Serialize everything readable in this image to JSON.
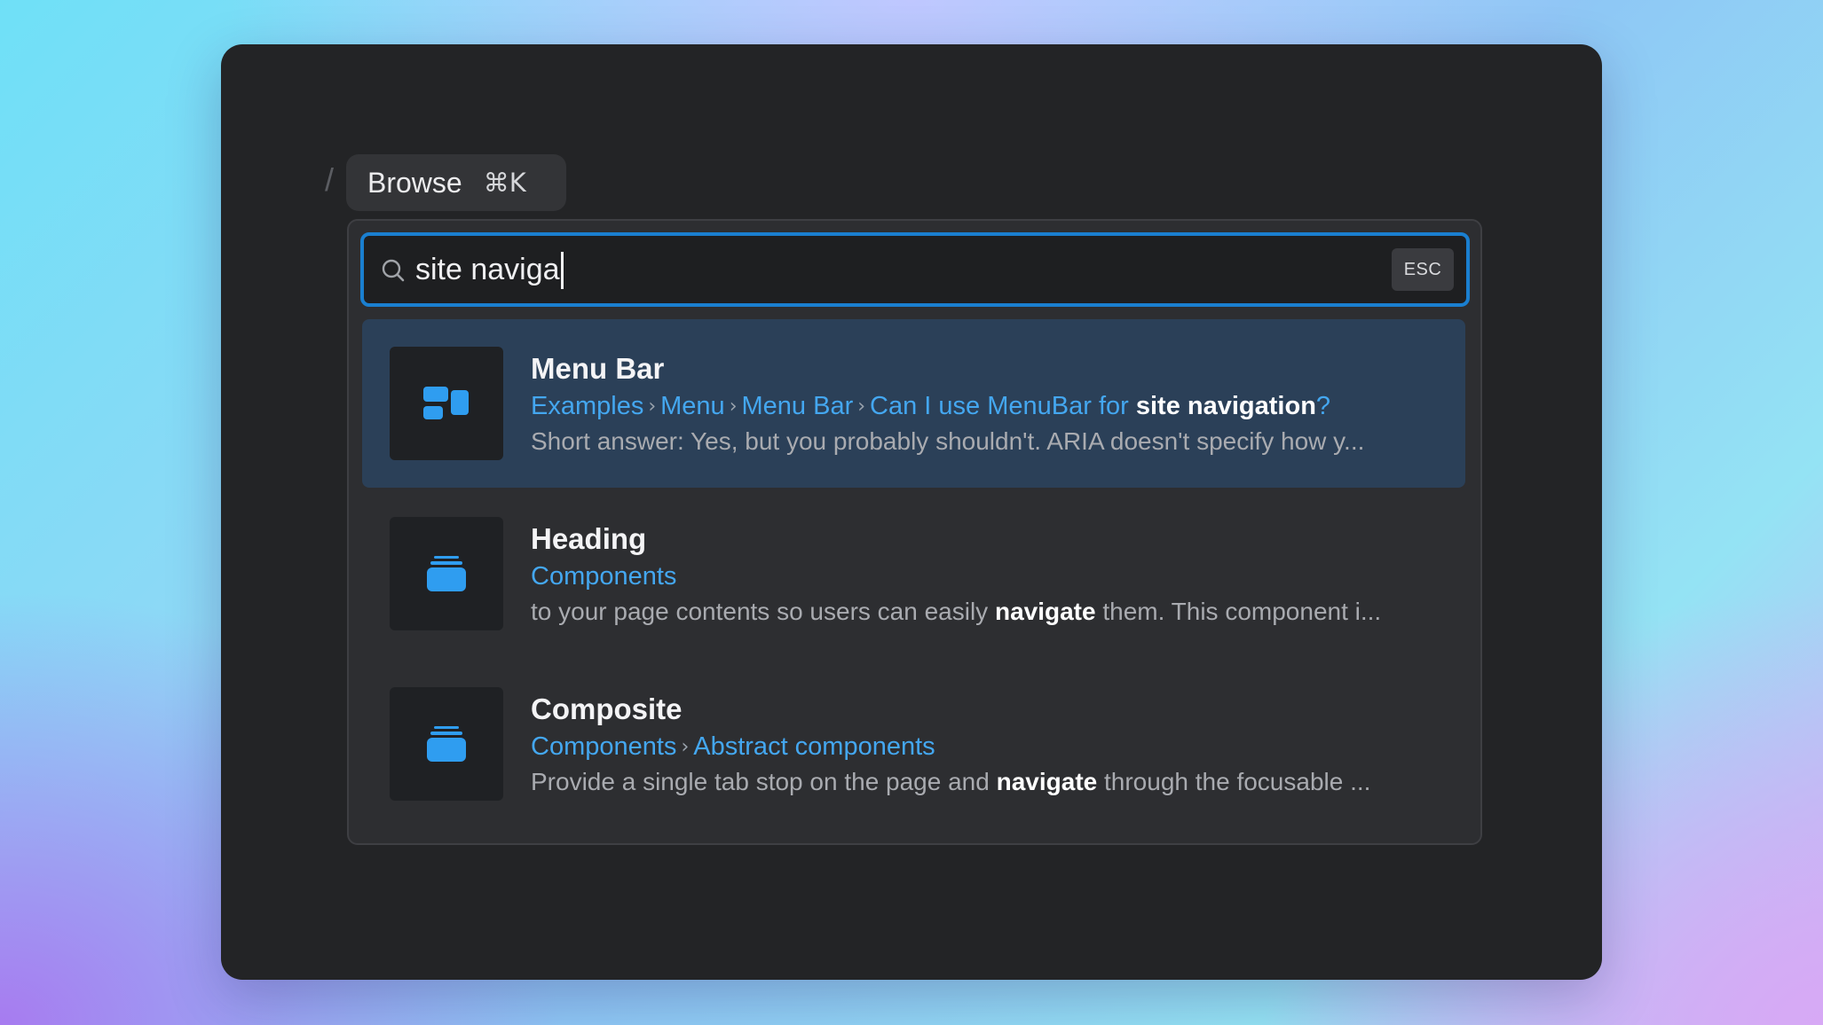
{
  "header": {
    "separator": "/",
    "browse_label": "Browse",
    "browse_shortcut": "⌘K"
  },
  "search": {
    "value": "site naviga",
    "esc_label": "ESC"
  },
  "results": [
    {
      "title": "Menu Bar",
      "icon": "menubar-icon",
      "breadcrumb": [
        "Examples",
        "Menu",
        "Menu Bar"
      ],
      "breadcrumb_last_prefix": "Can I use MenuBar for ",
      "breadcrumb_last_highlight": "site navigation",
      "breadcrumb_last_suffix": "?",
      "description_before": "Short answer: Yes, but you probably shouldn't. ARIA doesn't specify how y...",
      "description_highlight": "",
      "description_after": "",
      "selected": true
    },
    {
      "title": "Heading",
      "icon": "stack-icon",
      "breadcrumb": [
        "Components"
      ],
      "description_before": "to your page contents so users can easily ",
      "description_highlight": "navigate",
      "description_after": " them. This component i...",
      "selected": false
    },
    {
      "title": "Composite",
      "icon": "stack-icon",
      "breadcrumb": [
        "Components",
        "Abstract components"
      ],
      "description_before": "Provide a single tab stop on the page and ",
      "description_highlight": "navigate",
      "description_after": " through the focusable ...",
      "selected": false
    }
  ],
  "colors": {
    "accent": "#44a7f0",
    "focus_ring": "#1a7fd0",
    "selected_bg": "#2b4058",
    "window_bg": "#232426",
    "panel_bg": "#2d2e31"
  }
}
